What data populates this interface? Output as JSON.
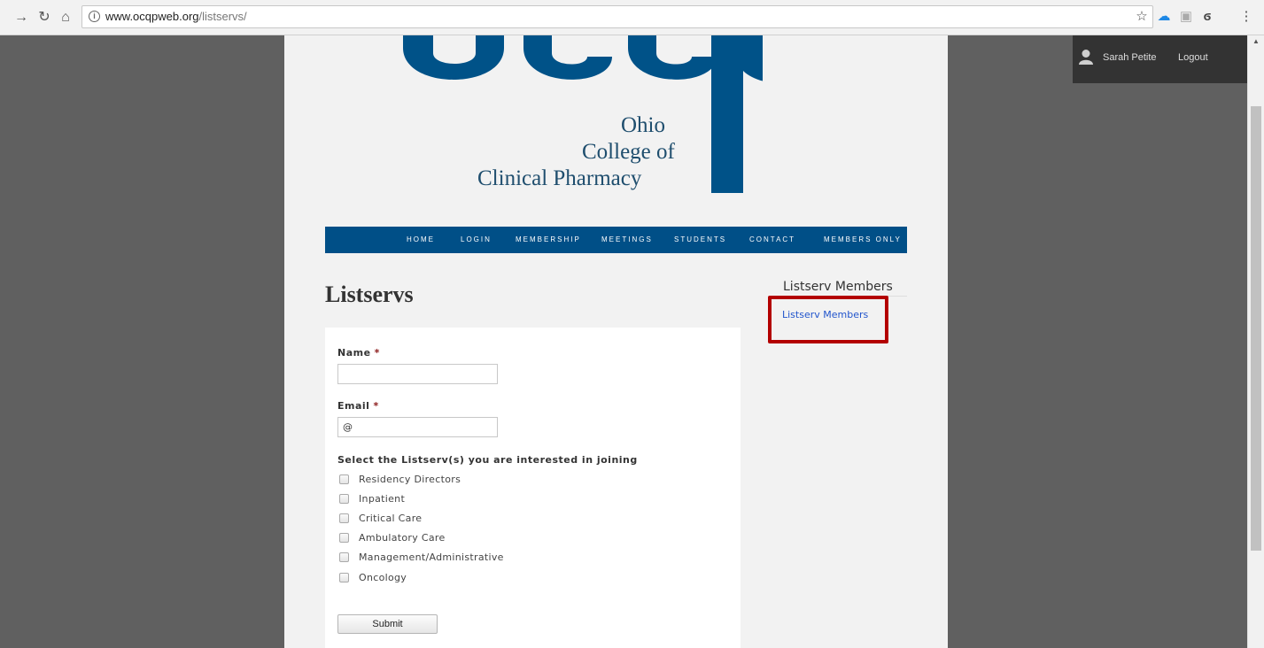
{
  "browser": {
    "url_host": "www.ocqpweb.org",
    "url_path": "/listservs/",
    "back_icon": "arrow-right",
    "reload_icon": "reload",
    "home_icon": "home"
  },
  "admin_bar": {
    "user_name": "Sarah Petite",
    "logout_label": "Logout"
  },
  "logo": {
    "line1": "Ohio",
    "line2": "College of",
    "line3": "Clinical Pharmacy",
    "color": "#005288"
  },
  "nav": {
    "items": [
      "HOME",
      "LOGIN",
      "MEMBERSHIP",
      "MEETINGS",
      "STUDENTS",
      "CONTACT",
      "MEMBERS ONLY"
    ]
  },
  "page": {
    "title": "Listservs"
  },
  "form": {
    "name_label": "Name",
    "email_label": "Email",
    "required_mark": "*",
    "name_value": "",
    "email_value": "@",
    "listserv_question": "Select the Listserv(s) you are interested in joining",
    "options": [
      "Residency Directors",
      "Inpatient",
      "Critical Care",
      "Ambulatory Care",
      "Management/Administrative",
      "Oncology"
    ],
    "submit_label": "Submit"
  },
  "sidebar": {
    "title": "Listserv Members",
    "link": "Listserv Members",
    "highlight_color": "#b30000"
  }
}
